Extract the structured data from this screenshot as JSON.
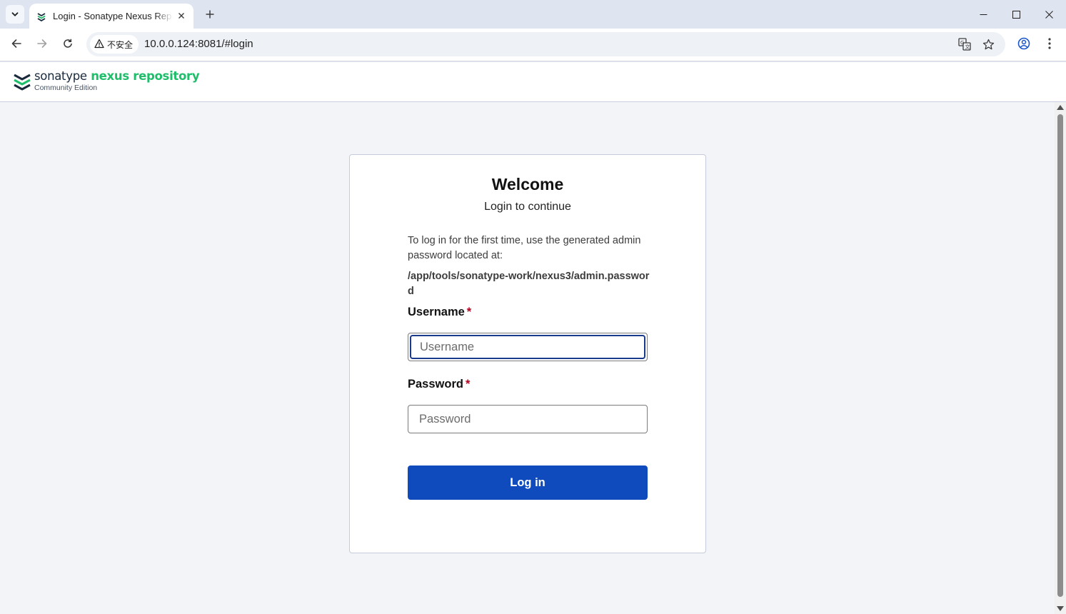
{
  "browser": {
    "tab_title": "Login - Sonatype Nexus Repository",
    "security_label": "不安全",
    "url": "10.0.0.124:8081/#login"
  },
  "app": {
    "brand_sonatype": "sonatype",
    "brand_product": "nexus repository",
    "brand_edition": "Community Edition"
  },
  "login": {
    "heading": "Welcome",
    "subheading": "Login to continue",
    "info_text": "To log in for the first time, use the generated admin password located at:",
    "info_path": "/app/tools/sonatype-work/nexus3/admin.password",
    "username_label": "Username",
    "username_placeholder": "Username",
    "username_value": "",
    "password_label": "Password",
    "password_placeholder": "Password",
    "password_value": "",
    "required_marker": "*",
    "submit_label": "Log in"
  },
  "colors": {
    "brand_green": "#1ebe6a",
    "primary_button": "#104bbe",
    "required_red": "#b3001e",
    "focus_ring": "#1a3a8c"
  }
}
